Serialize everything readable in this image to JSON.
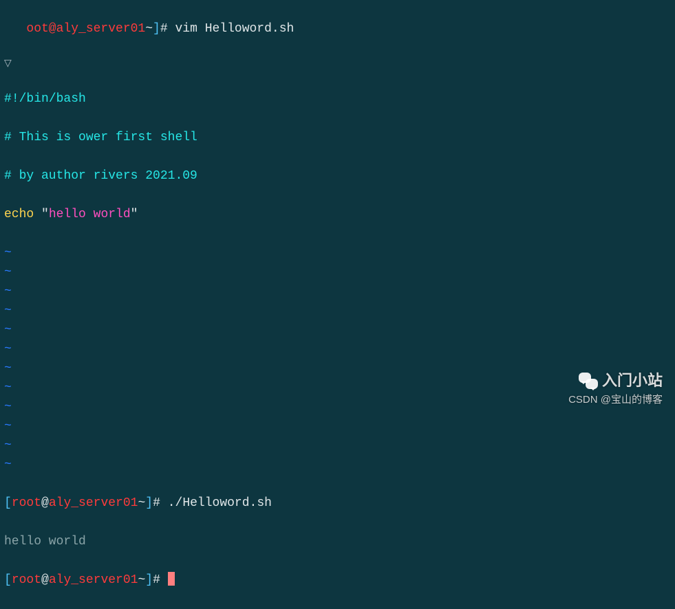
{
  "prompt1": {
    "user_host": "oot@aly_server01",
    "tilde": "~",
    "bracket_close": "]",
    "hash": "#",
    "command": "vim Helloword.sh"
  },
  "triangle": "▽",
  "script": {
    "shebang_hash": "#",
    "shebang_bang": "!/bin/bash",
    "comment1": "# This is ower first shell",
    "comment2": "# by author rivers 2021.09",
    "echo_kw": "echo",
    "quote_open": " \"",
    "echo_str": "hello world",
    "quote_close": "\""
  },
  "tilde": "~",
  "tilde_count_after_script": 12,
  "prompt2": {
    "bracket_open": "[",
    "user": "root",
    "at": "@",
    "host": "aly_server01",
    "tilde": "~",
    "bracket_close": "]",
    "hash": "#",
    "command": "./Helloword.sh"
  },
  "output": "hello world",
  "prompt3": {
    "bracket_open": "[",
    "user": "root",
    "at": "@",
    "host": "aly_server01",
    "tilde": "~",
    "bracket_close": "]",
    "hash": "#"
  },
  "watermark": {
    "top": "入门小站",
    "bottom": "CSDN @宝山的博客"
  }
}
